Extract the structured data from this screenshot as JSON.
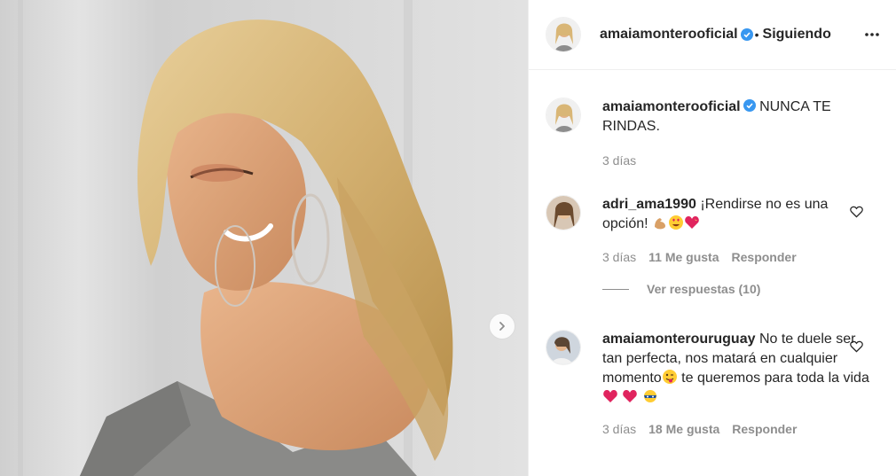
{
  "header": {
    "username": "amaiamonterooficial",
    "separator": "•",
    "follow_label": "Siguiendo"
  },
  "caption": {
    "username": "amaiamonterooficial",
    "text": "NUNCA TE RINDAS.",
    "time": "3 días"
  },
  "comments": [
    {
      "username": "adri_ama1990",
      "text": "¡Rendirse no es una opción!",
      "time": "3 días",
      "likes": "11 Me gusta",
      "reply_label": "Responder",
      "view_replies": "Ver respuestas (10)"
    },
    {
      "username": "amaiamonterouruguay",
      "text": "No te duele ser tan perfecta, nos matará en cualquier momento",
      "text2": " te queremos para toda la vida",
      "time": "3 días",
      "likes": "18 Me gusta",
      "reply_label": "Responder"
    }
  ],
  "icons": {
    "verified": "verified-badge-icon",
    "more": "more-options-icon",
    "like": "heart-outline-icon",
    "next": "chevron-right-icon"
  },
  "colors": {
    "verified": "#3897f0",
    "text": "#262626",
    "secondary": "#8e8e8e"
  }
}
